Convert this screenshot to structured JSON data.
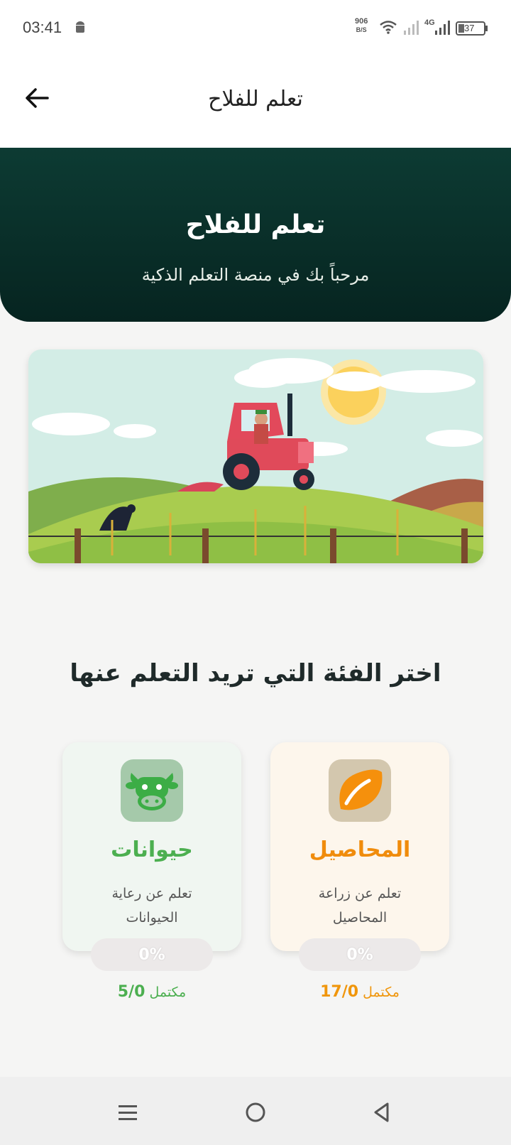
{
  "status_bar": {
    "time": "03:41",
    "net_speed_value": "906",
    "net_speed_unit": "B/S",
    "network_type": "4G",
    "battery": "37"
  },
  "app_bar": {
    "title": "تعلم للفلاح",
    "back_icon": "arrow-back-icon"
  },
  "hero": {
    "title": "تعلم للفلاح",
    "subtitle": "مرحباً بك في منصة التعلم الذكية"
  },
  "banner": {
    "image": "farmer-tractor-illustration"
  },
  "section_title": "اختر الفئة التي تريد التعلم عنها",
  "categories": [
    {
      "key": "crops",
      "icon": "leaf-icon",
      "title": "المحاصيل",
      "description": "تعلم عن زراعة المحاصيل",
      "progress": "0%",
      "count": "17/0",
      "count_suffix": "مكتمل",
      "accent": "#f08c0c"
    },
    {
      "key": "animals",
      "icon": "cow-icon",
      "title": "حيوانات",
      "description": "تعلم عن رعاية الحيوانات",
      "progress": "0%",
      "count": "5/0",
      "count_suffix": "مكتمل",
      "accent": "#4caf50"
    }
  ],
  "nav_bar": {
    "menu_icon": "menu-icon",
    "home_icon": "home-circle-icon",
    "back_icon": "back-triangle-icon"
  }
}
